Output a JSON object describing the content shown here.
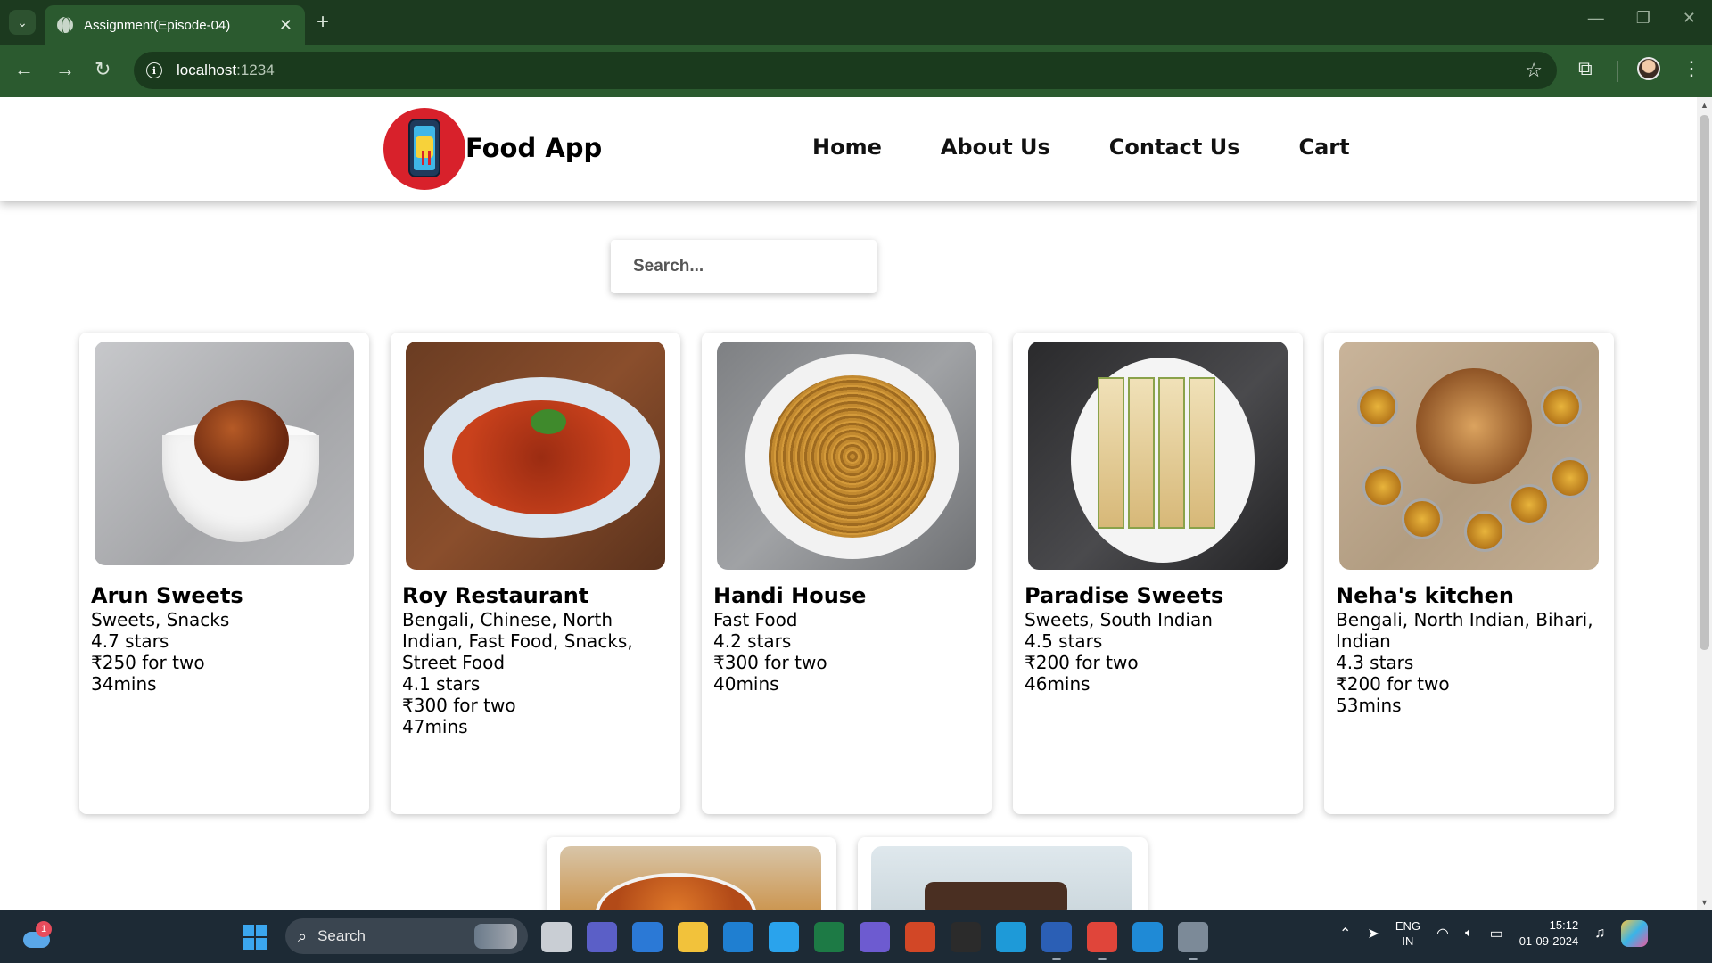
{
  "browser": {
    "tab_title": "Assignment(Episode-04)",
    "url_host": "localhost",
    "url_port": ":1234"
  },
  "app": {
    "brand": "Food App",
    "nav": [
      "Home",
      "About Us",
      "Contact Us",
      "Cart"
    ],
    "search_placeholder": "Search..."
  },
  "restaurants": [
    {
      "name": "Arun Sweets",
      "cuisines": "Sweets, Snacks",
      "rating": "4.7 stars",
      "cost": "₹250 for two",
      "time": "34mins"
    },
    {
      "name": "Roy Restaurant",
      "cuisines": "Bengali, Chinese, North Indian, Fast Food, Snacks, Street Food",
      "rating": "4.1 stars",
      "cost": "₹300 for two",
      "time": "47mins"
    },
    {
      "name": "Handi House",
      "cuisines": "Fast Food",
      "rating": "4.2 stars",
      "cost": "₹300 for two",
      "time": "40mins"
    },
    {
      "name": "Paradise Sweets",
      "cuisines": "Sweets, South Indian",
      "rating": "4.5 stars",
      "cost": "₹200 for two",
      "time": "46mins"
    },
    {
      "name": "Neha's kitchen",
      "cuisines": "Bengali, North Indian, Bihari, Indian",
      "rating": "4.3 stars",
      "cost": "₹200 for two",
      "time": "53mins"
    }
  ],
  "taskbar": {
    "search_label": "Search",
    "weather_badge": "1",
    "lang_top": "ENG",
    "lang_bottom": "IN",
    "time": "15:12",
    "date": "01-09-2024",
    "apps": [
      {
        "name": "task-view-icon",
        "color": "#c9ced4"
      },
      {
        "name": "teams-icon",
        "color": "#5b5fc7"
      },
      {
        "name": "store-icon",
        "color": "#2b79d6"
      },
      {
        "name": "file-explorer-icon",
        "color": "#f2c23b"
      },
      {
        "name": "myhp-icon",
        "color": "#1f7fd1"
      },
      {
        "name": "get-help-icon",
        "color": "#2aa3ec"
      },
      {
        "name": "excel-icon",
        "color": "#1d7a45"
      },
      {
        "name": "copilot-app-icon",
        "color": "#6d5bd0"
      },
      {
        "name": "powerpoint-icon",
        "color": "#d24726"
      },
      {
        "name": "terminal-icon",
        "color": "#2b2b2b"
      },
      {
        "name": "edge-icon",
        "color": "#1e9ad8"
      },
      {
        "name": "word-icon",
        "color": "#2b5fb5"
      },
      {
        "name": "chrome-icon",
        "color": "#e0453a"
      },
      {
        "name": "vscode-icon",
        "color": "#1f8ad6"
      },
      {
        "name": "settings-icon",
        "color": "#7c8a98"
      }
    ]
  },
  "colors": {
    "chrome_dark": "#1c3a1f",
    "chrome_toolbar": "#2b5a2f",
    "logo_red": "#d8212b"
  }
}
